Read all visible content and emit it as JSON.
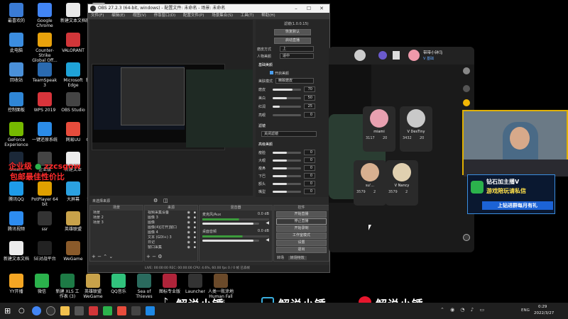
{
  "desktop_icons": [
    {
      "label": "最喜欢的",
      "color": "#3a7bd5"
    },
    {
      "label": "Google Chrome",
      "color": "#4285f4"
    },
    {
      "label": "新建文本文档",
      "color": "#e9e9e9"
    },
    {
      "label": "新建文本文档 (2)",
      "color": "#e9e9e9"
    },
    {
      "label": "此电脑",
      "color": "#3b8de0"
    },
    {
      "label": "Counter-Strike Global Off...",
      "color": "#e8a20c"
    },
    {
      "label": "VALORANT",
      "color": "#d13639"
    },
    {
      "label": "WeGame",
      "color": "#8a5a2a"
    },
    {
      "label": "回收站",
      "color": "#4a90d9"
    },
    {
      "label": "TeamSpeak 3",
      "color": "#2a6ab0"
    },
    {
      "label": "Microsoft Edge",
      "color": "#1fa3d8"
    },
    {
      "label": "新建文本文档",
      "color": "#e9e9e9"
    },
    {
      "label": "控制面板",
      "color": "#2f86d6"
    },
    {
      "label": "WPS 2019",
      "color": "#d8343b"
    },
    {
      "label": "OBS Studio",
      "color": "#444"
    },
    {
      "label": "恐怖之地",
      "color": "#ececec"
    },
    {
      "label": "GeForce Experience",
      "color": "#76b900"
    },
    {
      "label": "一键还原系统",
      "color": "#2b8ce8"
    },
    {
      "label": "网易UU",
      "color": "#e74c3c"
    },
    {
      "label": "CSGO配置文件",
      "color": "#ececec"
    },
    {
      "label": "Steam",
      "color": "#1b2838"
    },
    {
      "label": "企业版",
      "color": "#444"
    },
    {
      "label": "新建文本",
      "color": "#ececec"
    },
    {
      "label": "MW",
      "color": "#222"
    },
    {
      "label": "腾讯QQ",
      "color": "#1e9be8"
    },
    {
      "label": "PotPlayer 64 bit",
      "color": "#e0a000"
    },
    {
      "label": "大屏幕",
      "color": "#2ba1e0"
    },
    {
      "label": "新建 XLS 工作表",
      "color": "#1d7a45"
    },
    {
      "label": "腾讯视频",
      "color": "#2d8cf0"
    },
    {
      "label": "ssr",
      "color": "#333"
    },
    {
      "label": "英雄联盟",
      "color": "#c8a24a"
    },
    {
      "label": "解锁增强版",
      "color": "#333"
    },
    {
      "label": "新建文本文档",
      "color": "#ececec"
    },
    {
      "label": "5E对战平台",
      "color": "#222"
    },
    {
      "label": "WeGame",
      "color": "#8a5a2a"
    },
    {
      "label": "迅雷",
      "color": "#1e88e5"
    },
    {
      "label": "YY开播",
      "color": "#f5a623"
    },
    {
      "label": "微信",
      "color": "#2bb24c"
    },
    {
      "label": "新建 XLS 工作表 (3)",
      "color": "#1d7a45"
    },
    {
      "label": "英雄联盟WeGame",
      "color": "#c8a24a"
    },
    {
      "label": "QQ音乐",
      "color": "#31c27c"
    },
    {
      "label": "Sea of Thieves",
      "color": "#2a6b5e"
    },
    {
      "label": "图标专业版",
      "color": "#b0243a"
    },
    {
      "label": "Launcher",
      "color": "#333"
    },
    {
      "label": "人类一败涂地 Human Fall Flat",
      "color": "#6b4a2a"
    }
  ],
  "obs": {
    "title": "OBS 27.2.3 (64-bit, windows) - 配置文件: 未命名 - 场景: 未命名",
    "menu": [
      "文件(F)",
      "编辑(E)",
      "视图(V)",
      "停靠窗口(D)",
      "配置文件(P)",
      "场景集合(S)",
      "工具(T)",
      "帮助(H)"
    ],
    "filter_label": "滤镜(1.0.0.15)",
    "buttons": [
      "恢复默认",
      "启动直播"
    ],
    "rows": [
      {
        "label": "磨皮方式",
        "value": "上"
      },
      {
        "label": "人物美颜",
        "value": "适中"
      }
    ],
    "basic_beauty": "基础美颜",
    "toggle": "开启美颜",
    "mode_label": "美肤模式",
    "mode_value": "精致磨皮",
    "sliders": [
      {
        "label": "磨皮",
        "value": "70",
        "fill": 0.7
      },
      {
        "label": "美白",
        "value": "50",
        "fill": 0.5
      },
      {
        "label": "红润",
        "value": "25",
        "fill": 0.25
      },
      {
        "label": "亮眼",
        "value": "0",
        "fill": 0
      }
    ],
    "filter_section": "滤镜",
    "filter_select": "关闭滤镜",
    "advanced": "高级美颜",
    "adv_sliders": [
      {
        "label": "瘦脸",
        "value": "0"
      },
      {
        "label": "大眼",
        "value": "0"
      },
      {
        "label": "瘦鼻",
        "value": "0"
      },
      {
        "label": "下巴",
        "value": "0"
      },
      {
        "label": "额头",
        "value": "0"
      },
      {
        "label": "嘴型",
        "value": "0"
      }
    ],
    "scene_header": "场景",
    "scenes": [
      "场景",
      "场景 2",
      "场景 3"
    ],
    "source_header": "来源",
    "sources": [
      "视频采集设备",
      "图像 3",
      "图像",
      "图像(4)[打开]窗口",
      "图像 4",
      "文本 (GDI+) 3",
      "日记",
      "窗口采集"
    ],
    "mixer_header": "混音器",
    "mixer": [
      {
        "name": "麦克风/Aux",
        "db": "0.0 dB",
        "level": 0.55
      },
      {
        "name": "桌面音频",
        "db": "0.0 dB",
        "level": 0.6
      }
    ],
    "controls_header": "控件",
    "controls": [
      "开始直播",
      "停止直播",
      "开始录制",
      "工作室模式",
      "设置",
      "退出"
    ],
    "controls_active": "停止直播",
    "transition_label": "转场特效",
    "trans_select": "转场",
    "statusbar": "LIVE: 00:00:00  REC: 00:00:00  CPU: 4.6%, 60.00 fps  0 / 0 帧 已丢帧",
    "search_placeholder": "未选择来源"
  },
  "taskbar": {
    "time": "0:29",
    "date": "2022/3/27",
    "lang": "ENG"
  },
  "stream_app": {
    "host_name": "带带小钟马",
    "host_sub": "V 基础",
    "cards": [
      {
        "name": "miami",
        "stat1": "3117",
        "stat2": "20"
      },
      {
        "name": "V DesTiny",
        "stat1": "3432",
        "stat2": "20"
      },
      {
        "name": "su'...",
        "stat1": "3579",
        "stat2": "2"
      },
      {
        "name": "V Nancy",
        "stat1": "3579",
        "stat2": "2"
      }
    ]
  },
  "overlay": {
    "red_text": "企业级",
    "id_text": "zzcsgow",
    "promo_text": "包邮最佳性价比",
    "ad_line1": "钻石加主播V",
    "ad_line2": "游戏陪玩请私信",
    "ad_line3": "上钻进群每月有礼",
    "watermarks": [
      "解说小锤",
      "解说小锤",
      "解说小锤"
    ]
  }
}
